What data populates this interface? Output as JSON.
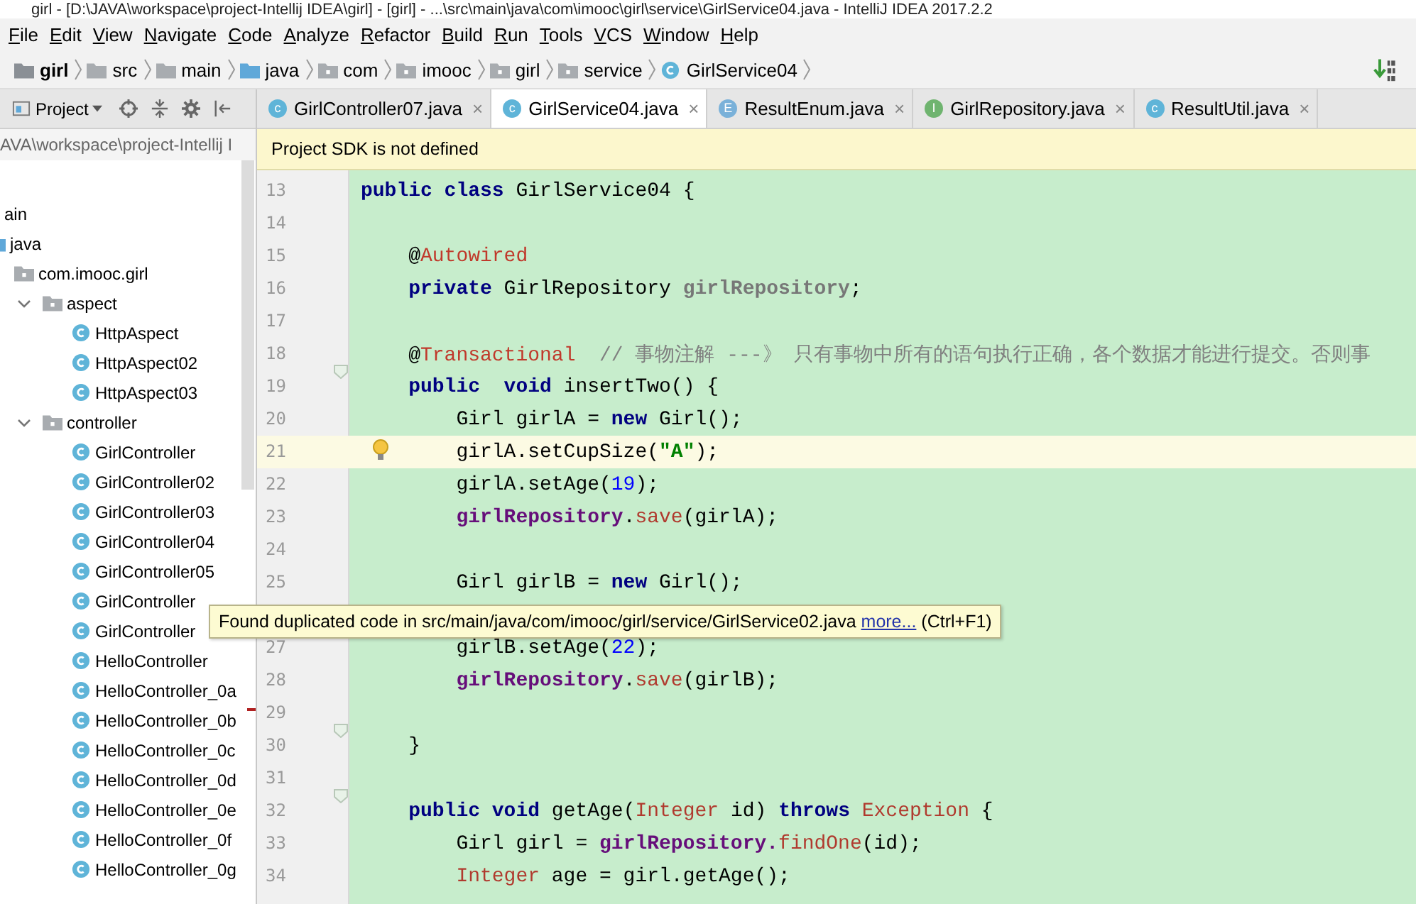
{
  "window": {
    "title": "girl - [D:\\JAVA\\workspace\\project-Intellij IDEA\\girl] - [girl] - ...\\src\\main\\java\\com\\imooc\\girl\\service\\GirlService04.java - IntelliJ IDEA 2017.2.2"
  },
  "menu": [
    "File",
    "Edit",
    "View",
    "Navigate",
    "Code",
    "Analyze",
    "Refactor",
    "Build",
    "Run",
    "Tools",
    "VCS",
    "Window",
    "Help"
  ],
  "breadcrumb": [
    {
      "label": "girl",
      "kind": "module"
    },
    {
      "label": "src",
      "kind": "folder"
    },
    {
      "label": "main",
      "kind": "folder"
    },
    {
      "label": "java",
      "kind": "source"
    },
    {
      "label": "com",
      "kind": "package"
    },
    {
      "label": "imooc",
      "kind": "package"
    },
    {
      "label": "girl",
      "kind": "package"
    },
    {
      "label": "service",
      "kind": "package"
    },
    {
      "label": "GirlService04",
      "kind": "class"
    }
  ],
  "sidebar": {
    "title": "Project",
    "path": "AVA\\workspace\\project-Intellij I",
    "tree": [
      {
        "label": "ain",
        "children": [
          {
            "label": "java",
            "kind": "source",
            "children": [
              {
                "label": "com.imooc.girl",
                "kind": "package",
                "children": [
                  {
                    "label": "aspect",
                    "kind": "package",
                    "expanded": true,
                    "children": [
                      {
                        "label": "HttpAspect",
                        "kind": "class"
                      },
                      {
                        "label": "HttpAspect02",
                        "kind": "class"
                      },
                      {
                        "label": "HttpAspect03",
                        "kind": "class"
                      }
                    ]
                  },
                  {
                    "label": "controller",
                    "kind": "package",
                    "expanded": true,
                    "children": [
                      {
                        "label": "GirlController",
                        "kind": "class"
                      },
                      {
                        "label": "GirlController02",
                        "kind": "class"
                      },
                      {
                        "label": "GirlController03",
                        "kind": "class"
                      },
                      {
                        "label": "GirlController04",
                        "kind": "class"
                      },
                      {
                        "label": "GirlController05",
                        "kind": "class"
                      },
                      {
                        "label": "GirlController",
                        "kind": "class"
                      },
                      {
                        "label": "GirlController",
                        "kind": "class"
                      },
                      {
                        "label": "HelloController",
                        "kind": "class"
                      },
                      {
                        "label": "HelloController_0a",
                        "kind": "class"
                      },
                      {
                        "label": "HelloController_0b",
                        "kind": "class"
                      },
                      {
                        "label": "HelloController_0c",
                        "kind": "class"
                      },
                      {
                        "label": "HelloController_0d",
                        "kind": "class"
                      },
                      {
                        "label": "HelloController_0e",
                        "kind": "class"
                      },
                      {
                        "label": "HelloController_0f",
                        "kind": "class"
                      },
                      {
                        "label": "HelloController_0g",
                        "kind": "class"
                      }
                    ]
                  }
                ]
              }
            ]
          }
        ]
      }
    ]
  },
  "tabs": [
    {
      "label": "GirlController07.java",
      "kind": "class",
      "icon": "c",
      "selected": false,
      "close": "×"
    },
    {
      "label": "GirlService04.java",
      "kind": "class",
      "icon": "c",
      "selected": true,
      "close": "×"
    },
    {
      "label": "ResultEnum.java",
      "kind": "enum",
      "icon": "E",
      "selected": false,
      "close": "×"
    },
    {
      "label": "GirlRepository.java",
      "kind": "interface",
      "icon": "I",
      "selected": false,
      "close": "×"
    },
    {
      "label": "ResultUtil.java",
      "kind": "class",
      "icon": "c",
      "selected": false,
      "close": "×"
    }
  ],
  "banner": "Project SDK is not defined",
  "editor": {
    "lines": [
      {
        "n": "13",
        "kind": "class",
        "code": [
          {
            "kind": "keyword",
            "text": "public class"
          },
          {
            "kind": "plain",
            "text": " GirlService04 {"
          }
        ]
      },
      {
        "n": "14",
        "kind": "blank"
      },
      {
        "n": "15",
        "kind": "member",
        "code": [
          {
            "kind": "plain",
            "text": "@"
          },
          {
            "kind": "annotation",
            "text": "Autowired"
          }
        ]
      },
      {
        "n": "16",
        "kind": "member",
        "code": [
          {
            "kind": "keyword",
            "text": "private"
          },
          {
            "kind": "plain",
            "text": " GirlRepository "
          },
          {
            "kind": "unused",
            "text": "girlRepository"
          },
          {
            "kind": "plain",
            "text": ";"
          }
        ]
      },
      {
        "n": "17",
        "kind": "blank"
      },
      {
        "n": "18",
        "kind": "member",
        "code": [
          {
            "kind": "plain",
            "text": "@"
          },
          {
            "kind": "annotation",
            "text": "Transactional"
          },
          {
            "kind": "comment",
            "text": "  // 事物注解 ---》 只有事物中所有的语句执行正确，各个数据才能进行提交。否则事"
          }
        ]
      },
      {
        "n": "19",
        "kind": "member",
        "fold": true,
        "code": [
          {
            "kind": "keyword",
            "text": "public  void"
          },
          {
            "kind": "plain",
            "text": " insertTwo() {"
          }
        ]
      },
      {
        "n": "20",
        "kind": "statement",
        "code": [
          {
            "kind": "plain",
            "text": "Girl girlA = "
          },
          {
            "kind": "keyword",
            "text": "new"
          },
          {
            "kind": "plain",
            "text": " Girl();"
          }
        ]
      },
      {
        "n": "21",
        "kind": "statement",
        "current": true,
        "bulb": true,
        "code": [
          {
            "kind": "plain",
            "text": "girlA.setCupSize("
          },
          {
            "kind": "string",
            "text": "\"A\""
          },
          {
            "kind": "plain",
            "text": ");"
          }
        ]
      },
      {
        "n": "22",
        "kind": "statement",
        "code": [
          {
            "kind": "plain",
            "text": "girlA.setAge("
          },
          {
            "kind": "number",
            "text": "19"
          },
          {
            "kind": "plain",
            "text": ");"
          }
        ]
      },
      {
        "n": "23",
        "kind": "statement",
        "code": [
          {
            "kind": "field",
            "text": "girlRepository"
          },
          {
            "kind": "plain",
            "text": "."
          },
          {
            "kind": "call",
            "text": "save"
          },
          {
            "kind": "plain",
            "text": "(girlA);"
          }
        ]
      },
      {
        "n": "24",
        "kind": "blank"
      },
      {
        "n": "25",
        "kind": "statement",
        "code": [
          {
            "kind": "plain",
            "text": "Girl girlB = "
          },
          {
            "kind": "keyword",
            "text": "new"
          },
          {
            "kind": "plain",
            "text": " Girl();"
          }
        ]
      },
      {
        "kind": "covered"
      },
      {
        "n": "27",
        "kind": "statement",
        "code": [
          {
            "kind": "plain",
            "text": "girlB.setAge("
          },
          {
            "kind": "number",
            "text": "22"
          },
          {
            "kind": "plain",
            "text": ");"
          }
        ]
      },
      {
        "n": "28",
        "kind": "statement",
        "code": [
          {
            "kind": "field",
            "text": "girlRepository"
          },
          {
            "kind": "plain",
            "text": "."
          },
          {
            "kind": "call",
            "text": "save"
          },
          {
            "kind": "plain",
            "text": "(girlB);"
          }
        ]
      },
      {
        "n": "29",
        "kind": "blank"
      },
      {
        "n": "30",
        "kind": "member",
        "fold": true,
        "code": [
          {
            "kind": "plain",
            "text": "}"
          }
        ]
      },
      {
        "n": "31",
        "kind": "blank"
      },
      {
        "n": "32",
        "kind": "member",
        "fold": true,
        "code": [
          {
            "kind": "keyword",
            "text": "public void"
          },
          {
            "kind": "plain",
            "text": " getAge("
          },
          {
            "kind": "type",
            "text": "Integer"
          },
          {
            "kind": "plain",
            "text": " id) "
          },
          {
            "kind": "keyword",
            "text": "throws "
          },
          {
            "kind": "type",
            "text": "Exception"
          },
          {
            "kind": "plain",
            "text": " {"
          }
        ]
      },
      {
        "n": "33",
        "kind": "statement",
        "code": [
          {
            "kind": "plain",
            "text": "Girl girl = "
          },
          {
            "kind": "field",
            "text": "girlRepository."
          },
          {
            "kind": "call",
            "text": "findOne"
          },
          {
            "kind": "plain",
            "text": "(id);"
          }
        ]
      },
      {
        "n": "34",
        "kind": "statement",
        "code": [
          {
            "kind": "type",
            "text": "Integer"
          },
          {
            "kind": "plain",
            "text": " age = girl.getAge();"
          }
        ]
      }
    ]
  },
  "tooltip": {
    "text": "Found duplicated code in src/main/java/com/imooc/girl/service/GirlService02.java",
    "link": "more...",
    "shortcut": "(Ctrl+F1)"
  }
}
